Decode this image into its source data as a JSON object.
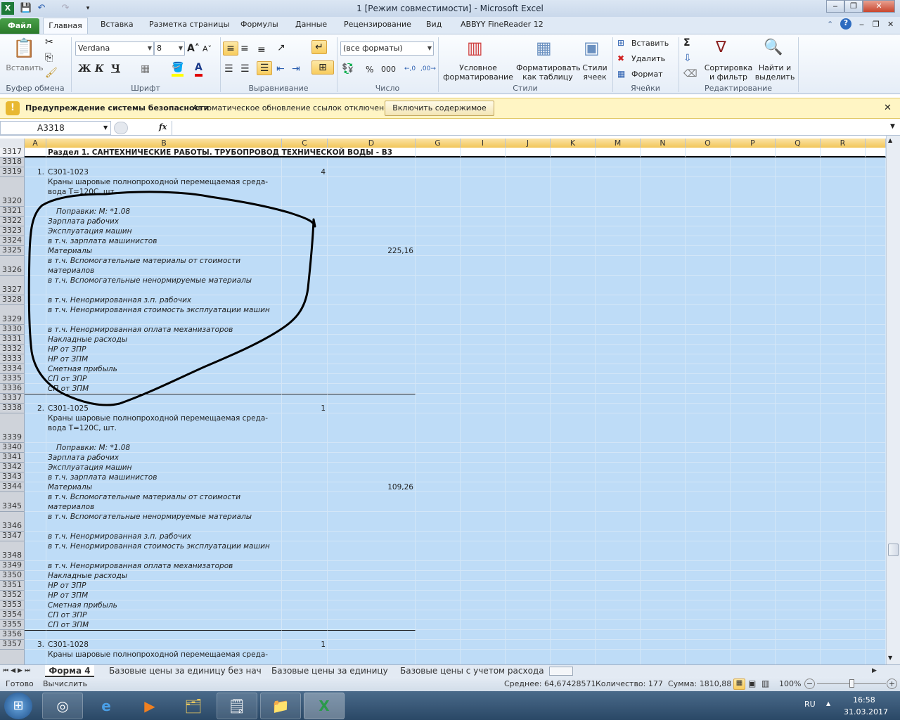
{
  "window": {
    "title": "1  [Режим совместимости]  -  Microsoft Excel"
  },
  "ribbon_tabs": [
    "Файл",
    "Главная",
    "Вставка",
    "Разметка страницы",
    "Формулы",
    "Данные",
    "Рецензирование",
    "Вид",
    "ABBYY FineReader 12"
  ],
  "ribbon": {
    "clipboard": {
      "paste": "Вставить",
      "label": "Буфер обмена"
    },
    "font": {
      "name": "Verdana",
      "size": "8",
      "bold": "Ж",
      "italic": "К",
      "underline": "Ч",
      "label": "Шрифт"
    },
    "alignment": {
      "label": "Выравнивание"
    },
    "number": {
      "format": "(все форматы)",
      "percent": "%",
      "thousands": "000",
      "label": "Число"
    },
    "styles": {
      "conditional": "Условное форматирование",
      "as_table": "Форматировать как таблицу",
      "cell_styles": "Стили ячеек",
      "label": "Стили"
    },
    "cells": {
      "insert": "Вставить",
      "delete": "Удалить",
      "format": "Формат",
      "label": "Ячейки"
    },
    "editing": {
      "sort": "Сортировка и фильтр",
      "find": "Найти и выделить",
      "label": "Редактирование"
    }
  },
  "security_bar": {
    "title": "Предупреждение системы безопасности",
    "message": "Автоматическое обновление ссылок отключено",
    "button": "Включить содержимое"
  },
  "formula_bar": {
    "name_box": "A3318",
    "fx": "fx",
    "value": ""
  },
  "columns": [
    "A",
    "B",
    "C",
    "D",
    "G",
    "I",
    "J",
    "K",
    "M",
    "N",
    "O",
    "P",
    "Q",
    "R"
  ],
  "sheet": {
    "rows": [
      {
        "n": "3317",
        "lines": 1,
        "style": "sect",
        "a": "",
        "b": "Раздел 1.  САНТЕХНИЧЕСКИЕ РАБОТЫ. ТРУБОПРОВОД ТЕХНИЧЕСКОЙ ВОДЫ - В3",
        "c": "",
        "d": ""
      },
      {
        "n": "3318",
        "lines": 1,
        "style": "",
        "a": "",
        "b": "",
        "c": "",
        "d": ""
      },
      {
        "n": "3319",
        "lines": 1,
        "style": "",
        "a": "1.",
        "b": "С301-1023",
        "c": "4",
        "d": ""
      },
      {
        "n": "3320",
        "lines": 3,
        "style": "",
        "a": "",
        "b": "Краны шаровые полнопроходной перемещаемая среда-вода Т=120С, шт.",
        "c": "",
        "d": ""
      },
      {
        "n": "3321",
        "lines": 1,
        "style": "it ind",
        "a": "",
        "b": "Поправки: М: *1.08",
        "c": "",
        "d": ""
      },
      {
        "n": "3322",
        "lines": 1,
        "style": "it",
        "a": "",
        "b": "Зарплата рабочих",
        "c": "",
        "d": ""
      },
      {
        "n": "3323",
        "lines": 1,
        "style": "it",
        "a": "",
        "b": "Эксплуатация машин",
        "c": "",
        "d": ""
      },
      {
        "n": "3324",
        "lines": 1,
        "style": "it",
        "a": "",
        "b": "в т.ч. зарплата машинистов",
        "c": "",
        "d": ""
      },
      {
        "n": "3325",
        "lines": 1,
        "style": "it",
        "a": "",
        "b": "Материалы",
        "c": "",
        "d": "225,16"
      },
      {
        "n": "3326",
        "lines": 2,
        "style": "it",
        "a": "",
        "b": "в т.ч. Вспомогательные материалы от стоимости материалов",
        "c": "",
        "d": ""
      },
      {
        "n": "3327",
        "lines": 2,
        "style": "it",
        "a": "",
        "b": "в т.ч. Вспомогательные ненормируемые материалы",
        "c": "",
        "d": ""
      },
      {
        "n": "3328",
        "lines": 1,
        "style": "it",
        "a": "",
        "b": "в т.ч. Ненормированная з.п. рабочих",
        "c": "",
        "d": ""
      },
      {
        "n": "3329",
        "lines": 2,
        "style": "it",
        "a": "",
        "b": "в т.ч. Ненормированная стоимость эксплуатации машин",
        "c": "",
        "d": ""
      },
      {
        "n": "3330",
        "lines": 1,
        "style": "it",
        "a": "",
        "b": "в т.ч. Ненормированная оплата механизаторов",
        "c": "",
        "d": ""
      },
      {
        "n": "3331",
        "lines": 1,
        "style": "it",
        "a": "",
        "b": "Накладные расходы",
        "c": "",
        "d": ""
      },
      {
        "n": "3332",
        "lines": 1,
        "style": "it",
        "a": "",
        "b": "НР от ЗПР",
        "c": "",
        "d": ""
      },
      {
        "n": "3333",
        "lines": 1,
        "style": "it",
        "a": "",
        "b": "НР от ЗПМ",
        "c": "",
        "d": ""
      },
      {
        "n": "3334",
        "lines": 1,
        "style": "it",
        "a": "",
        "b": "Сметная прибыль",
        "c": "",
        "d": ""
      },
      {
        "n": "3335",
        "lines": 1,
        "style": "it",
        "a": "",
        "b": "СП от ЗПР",
        "c": "",
        "d": ""
      },
      {
        "n": "3336",
        "lines": 1,
        "style": "it",
        "a": "",
        "b": "СП от ЗПМ",
        "c": "",
        "d": ""
      },
      {
        "n": "3337",
        "lines": 1,
        "style": "topline",
        "a": "",
        "b": "",
        "c": "",
        "d": ""
      },
      {
        "n": "3338",
        "lines": 1,
        "style": "",
        "a": "2.",
        "b": "С301-1025",
        "c": "1",
        "d": ""
      },
      {
        "n": "3339",
        "lines": 3,
        "style": "",
        "a": "",
        "b": "Краны шаровые полнопроходной перемещаемая среда-вода Т=120С, шт.",
        "c": "",
        "d": ""
      },
      {
        "n": "3340",
        "lines": 1,
        "style": "it ind",
        "a": "",
        "b": "Поправки: М: *1.08",
        "c": "",
        "d": ""
      },
      {
        "n": "3341",
        "lines": 1,
        "style": "it",
        "a": "",
        "b": "Зарплата рабочих",
        "c": "",
        "d": ""
      },
      {
        "n": "3342",
        "lines": 1,
        "style": "it",
        "a": "",
        "b": "Эксплуатация машин",
        "c": "",
        "d": ""
      },
      {
        "n": "3343",
        "lines": 1,
        "style": "it",
        "a": "",
        "b": "в т.ч. зарплата машинистов",
        "c": "",
        "d": ""
      },
      {
        "n": "3344",
        "lines": 1,
        "style": "it",
        "a": "",
        "b": "Материалы",
        "c": "",
        "d": "109,26"
      },
      {
        "n": "3345",
        "lines": 2,
        "style": "it",
        "a": "",
        "b": "в т.ч. Вспомогательные материалы от стоимости материалов",
        "c": "",
        "d": ""
      },
      {
        "n": "3346",
        "lines": 2,
        "style": "it",
        "a": "",
        "b": "в т.ч. Вспомогательные ненормируемые материалы",
        "c": "",
        "d": ""
      },
      {
        "n": "3347",
        "lines": 1,
        "style": "it",
        "a": "",
        "b": "в т.ч. Ненормированная з.п. рабочих",
        "c": "",
        "d": ""
      },
      {
        "n": "3348",
        "lines": 2,
        "style": "it",
        "a": "",
        "b": "в т.ч. Ненормированная стоимость эксплуатации машин",
        "c": "",
        "d": ""
      },
      {
        "n": "3349",
        "lines": 1,
        "style": "it",
        "a": "",
        "b": "в т.ч. Ненормированная оплата механизаторов",
        "c": "",
        "d": ""
      },
      {
        "n": "3350",
        "lines": 1,
        "style": "it",
        "a": "",
        "b": "Накладные расходы",
        "c": "",
        "d": ""
      },
      {
        "n": "3351",
        "lines": 1,
        "style": "it",
        "a": "",
        "b": "НР от ЗПР",
        "c": "",
        "d": ""
      },
      {
        "n": "3352",
        "lines": 1,
        "style": "it",
        "a": "",
        "b": "НР от ЗПМ",
        "c": "",
        "d": ""
      },
      {
        "n": "3353",
        "lines": 1,
        "style": "it",
        "a": "",
        "b": "Сметная прибыль",
        "c": "",
        "d": ""
      },
      {
        "n": "3354",
        "lines": 1,
        "style": "it",
        "a": "",
        "b": "СП от ЗПР",
        "c": "",
        "d": ""
      },
      {
        "n": "3355",
        "lines": 1,
        "style": "it",
        "a": "",
        "b": "СП от ЗПМ",
        "c": "",
        "d": ""
      },
      {
        "n": "3356",
        "lines": 1,
        "style": "topline",
        "a": "",
        "b": "",
        "c": "",
        "d": ""
      },
      {
        "n": "3357",
        "lines": 1,
        "style": "",
        "a": "3.",
        "b": "С301-1028",
        "c": "1",
        "d": ""
      },
      {
        "n": "",
        "lines": 3,
        "style": "",
        "a": "",
        "b": "Краны шаровые полнопроходной перемещаемая среда-",
        "c": "",
        "d": ""
      }
    ]
  },
  "sheet_tabs": [
    "Форма 4",
    "Базовые цены за единицу без нач",
    "Базовые цены за единицу",
    "Базовые цены с учетом расхода"
  ],
  "status": {
    "ready": "Готово",
    "calculate": "Вычислить",
    "average": "Среднее: 64,67428571",
    "count": "Количество: 177",
    "sum": "Сумма: 1810,88",
    "zoom": "100%",
    "zoom_fraction": 0.5
  },
  "taskbar": {
    "lang": "RU",
    "time": "16:58",
    "date": "31.03.2017"
  }
}
